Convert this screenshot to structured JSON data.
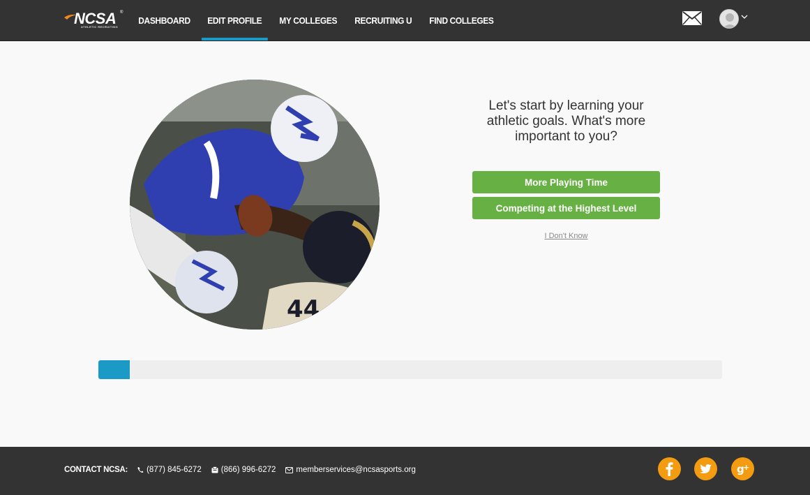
{
  "header": {
    "logo_text": "NCSA",
    "logo_subtext": "ATHLETIC RECRUITING",
    "nav": [
      {
        "label": "DASHBOARD",
        "active": false
      },
      {
        "label": "EDIT PROFILE",
        "active": true
      },
      {
        "label": "MY COLLEGES",
        "active": false
      },
      {
        "label": "RECRUITING U",
        "active": false
      },
      {
        "label": "FIND COLLEGES",
        "active": false
      }
    ],
    "icons": [
      "envelope-icon",
      "avatar",
      "chevron-down-icon"
    ]
  },
  "main": {
    "question": "Let's start by learning your athletic goals. What's more important to you?",
    "answers": [
      "More Playing Time",
      "Competing at the Highest Level"
    ],
    "dont_know": "I Don't Know",
    "progress_fraction": 0.05
  },
  "footer": {
    "contact_label": "CONTACT NCSA:",
    "phone": "(877) 845-6272",
    "fax": "(866) 996-6272",
    "email": "memberservices@ncsasports.org",
    "social": [
      "facebook-icon",
      "twitter-icon",
      "google-plus-icon"
    ]
  },
  "colors": {
    "nav_bg": "#333333",
    "accent_blue": "#1b9ac6",
    "button_green": "#67b043",
    "social_orange": "#f39c12",
    "logo_orange": "#f08a1c"
  }
}
